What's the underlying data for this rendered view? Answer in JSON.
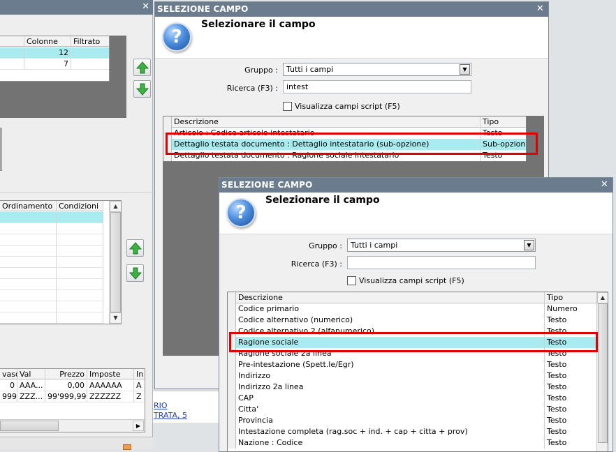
{
  "colors": {
    "titlebar": "#6a7c8e",
    "selection": "#a8ecef",
    "highlight_box": "#e00000",
    "dark_area": "#737373"
  },
  "background_window": {
    "close_icon": "✕",
    "top_grid": {
      "headers": [
        "Colonne",
        "Filtrato"
      ],
      "rows": [
        [
          "12",
          ""
        ],
        [
          "7",
          ""
        ]
      ]
    },
    "middle_grid": {
      "headers": [
        "Ordinamento",
        "Condizioni"
      ]
    },
    "bottom_grid": {
      "headers": [
        "vaso",
        "Val",
        "Prezzo",
        "Imposte",
        "In"
      ],
      "rows": [
        [
          "0",
          "AAA...",
          "0,00",
          "AAAAAA",
          "A"
        ],
        [
          "999",
          "ZZZ...",
          "99'999,99",
          "ZZZZZZ",
          "Z"
        ]
      ]
    },
    "links": [
      "RIO",
      "TRATA, 5"
    ]
  },
  "dialog1": {
    "title": "SELEZIONE CAMPO",
    "close_icon": "✕",
    "heading": "Selezionare il campo",
    "gruppo_label": "Gruppo :",
    "gruppo_value": "Tutti i campi",
    "ricerca_label": "Ricerca (F3) :",
    "ricerca_value": "intest",
    "checkbox_label": "Visualizza campi script (F5)",
    "columns": [
      "Descrizione",
      "Tipo"
    ],
    "rows": [
      {
        "descrizione": "Articolo : Codice articolo intestatario",
        "tipo": "Testo"
      },
      {
        "descrizione": "Dettaglio testata documento : Dettaglio intestatario (sub-opzione)",
        "tipo": "Sub-opzione"
      },
      {
        "descrizione": "Dettaglio testata documento : Ragione sociale intestatario",
        "tipo": "Testo"
      }
    ],
    "selected_index": 1
  },
  "dialog2": {
    "title": "SELEZIONE CAMPO",
    "close_icon": "✕",
    "heading": "Selezionare il campo",
    "gruppo_label": "Gruppo :",
    "gruppo_value": "Tutti i campi",
    "ricerca_label": "Ricerca (F3) :",
    "ricerca_value": "",
    "checkbox_label": "Visualizza campi script (F5)",
    "columns": [
      "Descrizione",
      "Tipo"
    ],
    "rows": [
      {
        "descrizione": "Codice primario",
        "tipo": "Numero"
      },
      {
        "descrizione": "Codice alternativo (numerico)",
        "tipo": "Testo"
      },
      {
        "descrizione": "Codice alternativo 2 (alfanumerico)",
        "tipo": "Testo"
      },
      {
        "descrizione": "Ragione sociale",
        "tipo": "Testo"
      },
      {
        "descrizione": "Ragione sociale 2a linea",
        "tipo": "Testo"
      },
      {
        "descrizione": "Pre-intestazione (Spett.le/Egr)",
        "tipo": "Testo"
      },
      {
        "descrizione": "Indirizzo",
        "tipo": "Testo"
      },
      {
        "descrizione": "Indirizzo 2a linea",
        "tipo": "Testo"
      },
      {
        "descrizione": "CAP",
        "tipo": "Testo"
      },
      {
        "descrizione": "Citta'",
        "tipo": "Testo"
      },
      {
        "descrizione": "Provincia",
        "tipo": "Testo"
      },
      {
        "descrizione": "Intestazione completa (rag.soc + ind. + cap + citta + prov)",
        "tipo": "Testo"
      },
      {
        "descrizione": "Nazione : Codice",
        "tipo": "Testo"
      }
    ],
    "selected_index": 3
  }
}
